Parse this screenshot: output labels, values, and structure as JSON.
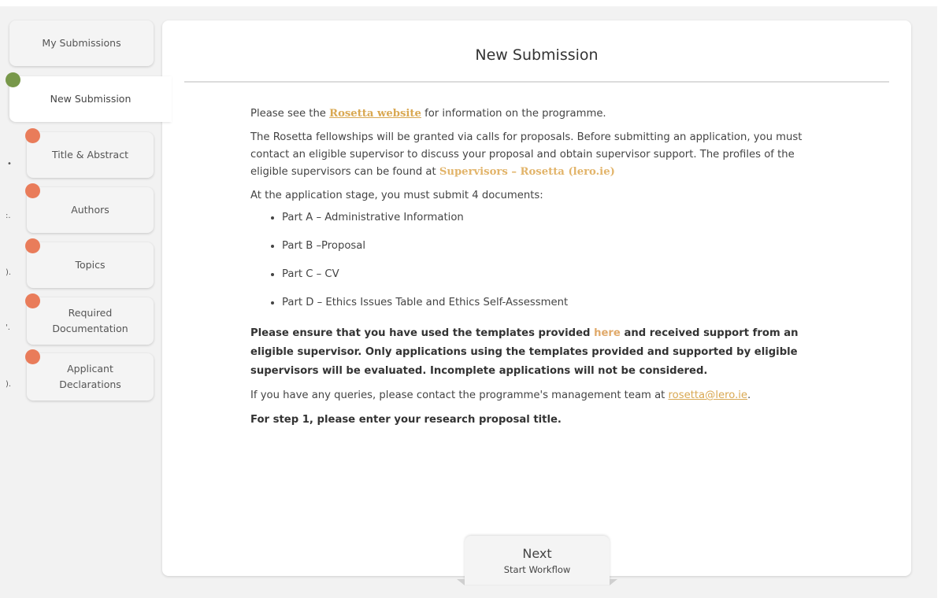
{
  "sidebar": {
    "my_submissions": "My Submissions",
    "new_submission": "New Submission",
    "steps": [
      {
        "label": "Title & Abstract"
      },
      {
        "label": "Authors"
      },
      {
        "label": "Topics"
      },
      {
        "label": "Required Documentation"
      },
      {
        "label": "Applicant Declarations"
      }
    ]
  },
  "panel": {
    "title": "New Submission",
    "intro_before": "Please see the ",
    "intro_link": "Rosetta website",
    "intro_after": " for information on the programme.",
    "para2": "The Rosetta fellowships will be granted via calls for proposals. Before submitting an application, you must contact an eligible supervisor to discuss your proposal and obtain supervisor support. The profiles of the eligible supervisors can be found at ",
    "para2_link": "Supervisors – Rosetta (lero.ie)",
    "para3": "At the application stage, you must submit 4 documents:",
    "documents": [
      "Part A – Administrative Information",
      "Part B –Proposal",
      "Part C – CV",
      "Part D – Ethics Issues Table and Ethics Self-Assessment"
    ],
    "notice_before": "Please ensure that you have used the templates provided ",
    "notice_link": "here",
    "notice_after": " and received support from an eligible supervisor. Only applications using the templates provided and supported by eligible supervisors will be evaluated. Incomplete applications will not be considered.",
    "contact_before": "If you have any queries, please contact the programme's management team at ",
    "contact_email": "rosetta@lero.ie",
    "contact_after": ".",
    "step1": "For step 1, please enter your research proposal title."
  },
  "next_button": {
    "label": "Next",
    "sublabel": "Start Workflow"
  },
  "colors": {
    "active_dot": "#78984a",
    "step_dot": "#e97c5a",
    "link": "#d9a852"
  }
}
